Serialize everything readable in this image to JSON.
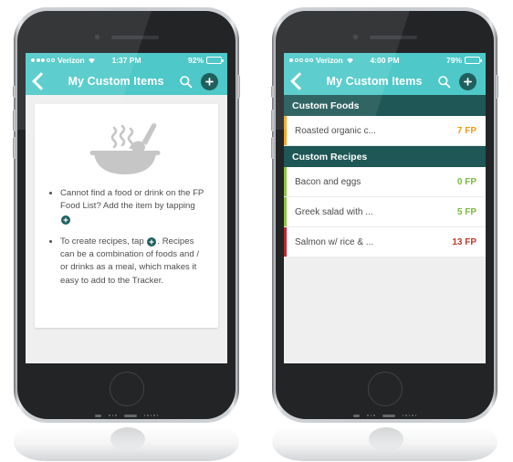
{
  "phones": [
    {
      "id": "left",
      "statusbar": {
        "signal_filled": 3,
        "signal_total": 5,
        "carrier": "Verizon",
        "wifi_icon": "wifi-icon",
        "time": "1:37 PM",
        "battery_text": "92%",
        "battery_level": 92
      },
      "navbar": {
        "back_icon": "chevron-left-icon",
        "title": "My Custom Items",
        "search_icon": "search-icon",
        "add_icon": "plus-icon"
      },
      "content": {
        "hero_icon": "soup-bowl-icon",
        "tips": [
          {
            "part1": "Cannot find a food or drink on the FP Food List? Add the item by tapping",
            "badge": "plus-icon",
            "part2": ""
          },
          {
            "part1": "To create recipes, tap",
            "badge": "plus-icon",
            "part2": ". Recipes can be a combination of foods and / or drinks as a meal, which makes it easy to add to the Tracker."
          }
        ]
      }
    },
    {
      "id": "right",
      "statusbar": {
        "signal_filled": 1,
        "signal_total": 5,
        "carrier": "Verizon",
        "wifi_icon": "wifi-icon",
        "time": "4:00 PM",
        "battery_text": "79%",
        "battery_level": 79
      },
      "navbar": {
        "back_icon": "chevron-left-icon",
        "title": "My Custom Items",
        "search_icon": "search-icon",
        "add_icon": "plus-icon"
      },
      "list": [
        {
          "type": "header",
          "label": "Custom Foods"
        },
        {
          "type": "row",
          "label": "Roasted organic c...",
          "value": "7 FP",
          "bar_color": "#f5a623",
          "value_color": "#f39c12"
        },
        {
          "type": "header",
          "label": "Custom Recipes"
        },
        {
          "type": "row",
          "label": "Bacon and eggs",
          "value": "0 FP",
          "bar_color": "#8dc63f",
          "value_color": "#7cbb3e"
        },
        {
          "type": "row",
          "label": "Greek salad with ...",
          "value": "5 FP",
          "bar_color": "#8dc63f",
          "value_color": "#7cbb3e"
        },
        {
          "type": "row",
          "label": "Salmon w/ rice & ...",
          "value": "13 FP",
          "bar_color": "#c1272d",
          "value_color": "#c0392b"
        }
      ]
    }
  ],
  "theme": {
    "nav_teal": "#4ec8c8",
    "header_dark_teal": "#1e5755",
    "screen_bg": "#efefef",
    "card_bg": "#ffffff",
    "text_gray": "#4f4f4f"
  }
}
